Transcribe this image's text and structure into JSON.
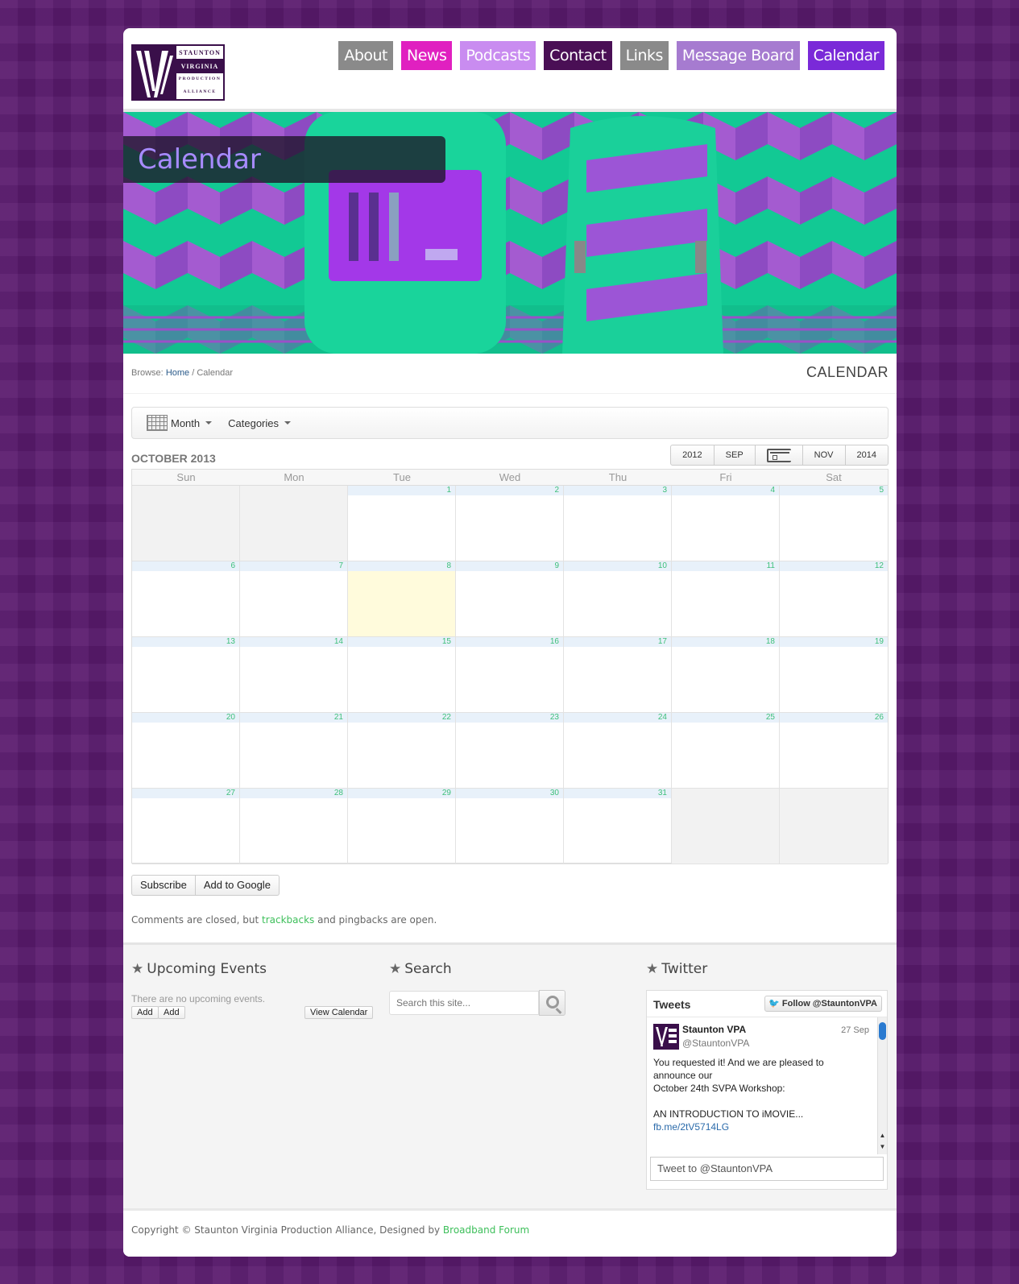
{
  "logo": {
    "line1": "STAUNTON",
    "line2": "VIRGINIA",
    "line3": "PRODUCTION",
    "line4": "ALLIANCE"
  },
  "nav": [
    {
      "label": "About",
      "color": "#8a8a8a"
    },
    {
      "label": "News",
      "color": "#e020c0"
    },
    {
      "label": "Podcasts",
      "color": "#c98cf0"
    },
    {
      "label": "Contact",
      "color": "#4a0f55"
    },
    {
      "label": "Links",
      "color": "#8a8a8a"
    },
    {
      "label": "Message Board",
      "color": "#a67bd0"
    },
    {
      "label": "Calendar",
      "color": "#7a2ad8"
    }
  ],
  "banner": {
    "title": "Calendar"
  },
  "breadcrumb": {
    "prefix": "Browse:",
    "home": "Home",
    "sep": "/",
    "current": "Calendar"
  },
  "page_heading": "CALENDAR",
  "calendar": {
    "toolbar": {
      "view": "Month",
      "categories": "Categories"
    },
    "month_label": "OCTOBER 2013",
    "nav": {
      "prev_year": "2012",
      "prev_month": "SEP",
      "next_month": "NOV",
      "next_year": "2014"
    },
    "days_of_week": [
      "Sun",
      "Mon",
      "Tue",
      "Wed",
      "Thu",
      "Fri",
      "Sat"
    ],
    "cells": [
      "",
      "",
      "1",
      "2",
      "3",
      "4",
      "5",
      "6",
      "7",
      "8",
      "9",
      "10",
      "11",
      "12",
      "13",
      "14",
      "15",
      "16",
      "17",
      "18",
      "19",
      "20",
      "21",
      "22",
      "23",
      "24",
      "25",
      "26",
      "27",
      "28",
      "29",
      "30",
      "31",
      "",
      ""
    ],
    "today": "8",
    "subscribe": "Subscribe",
    "add_to_google": "Add to Google"
  },
  "comments": {
    "before": "Comments are closed, but",
    "link": "trackbacks",
    "after": "and pingbacks are open."
  },
  "widgets": {
    "upcoming": {
      "title": "Upcoming Events",
      "empty": "There are no upcoming events.",
      "add1": "Add",
      "add2": "Add",
      "view": "View Calendar"
    },
    "search": {
      "title": "Search",
      "placeholder": "Search this site..."
    },
    "twitter": {
      "title": "Twitter",
      "tweets_label": "Tweets",
      "follow": "Follow @StauntonVPA",
      "name": "Staunton VPA",
      "handle": "@StauntonVPA",
      "date": "27 Sep",
      "text": "You requested it!  And we are pleased to announce our\nOctober 24th SVPA Workshop:\n\nAN INTRODUCTION TO iMOVIE...",
      "link": "fb.me/2tV5714LG",
      "tweet_to": "Tweet to @StauntonVPA"
    }
  },
  "footer": {
    "text": "Copyright © Staunton Virginia Production Alliance, Designed by",
    "link": "Broadband Forum"
  }
}
